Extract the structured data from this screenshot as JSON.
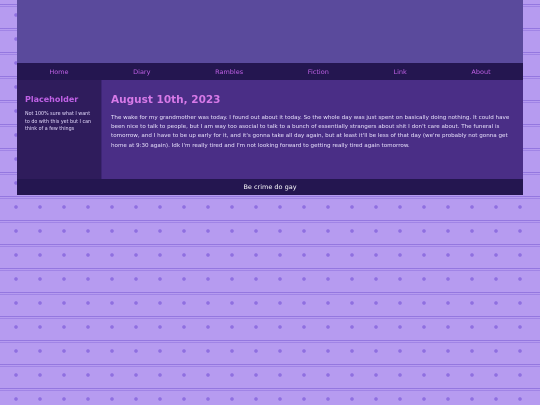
{
  "nav": {
    "items": [
      {
        "label": "Home"
      },
      {
        "label": "Diary"
      },
      {
        "label": "Rambles"
      },
      {
        "label": "Fiction"
      },
      {
        "label": "Link"
      },
      {
        "label": "About"
      }
    ]
  },
  "sidebar": {
    "title": "Placeholder",
    "text": "Not 100% sure what I want to do with this yet but I can think of a few things"
  },
  "post": {
    "title": "August 10th, 2023",
    "body": "The wake for my grandmother was today. I found out about it today. So the whole day was just spent on basically doing nothing. It could have been nice to talk to people, but I am way too asocial to talk to a bunch of essentially strangers about shit I don't care about. The funeral is tomorrow, and I have to be up early for it, and it's gonna take all day again, but at least it'll be less of that day (we're probably not gonna get home at 9:30 again). Idk I'm really tired and I'm not looking forward to getting really tired again tomorrow."
  },
  "footer": {
    "text": "Be crime do gay"
  },
  "colors": {
    "accent": "#c061e6",
    "nav_bg": "#241650",
    "banner_bg": "#5a4a9c",
    "main_bg": "#4a2e86",
    "page_bg": "#b69bf0"
  }
}
